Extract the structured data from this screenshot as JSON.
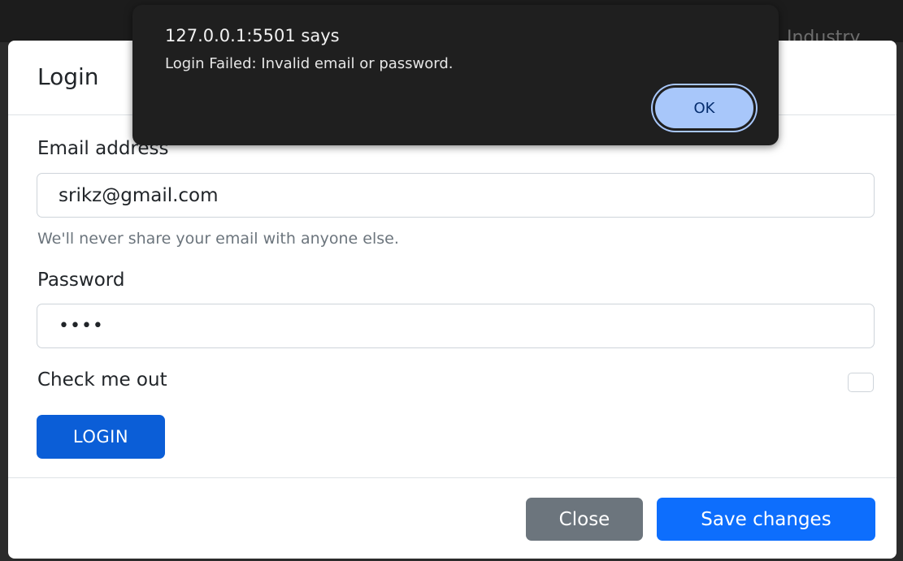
{
  "background": {
    "nav_text": "Industry"
  },
  "modal": {
    "title": "Login",
    "email_label": "Email address",
    "email_value": "srikz@gmail.com",
    "email_help": "We'll never share your email with anyone else.",
    "password_label": "Password",
    "password_value": "••••",
    "checkbox_label": "Check me out",
    "checkbox_checked": false,
    "login_button": "LOGIN",
    "close_button": "Close",
    "save_button": "Save changes"
  },
  "alert": {
    "origin": "127.0.0.1:5501 says",
    "message": "Login Failed: Invalid email or password.",
    "ok_button": "OK"
  },
  "colors": {
    "primary": "#0d6efd",
    "login_button": "#0b5ed7",
    "secondary": "#6c757d",
    "alert_bg": "#1f1f1f",
    "alert_ok": "#a8c7fa"
  }
}
